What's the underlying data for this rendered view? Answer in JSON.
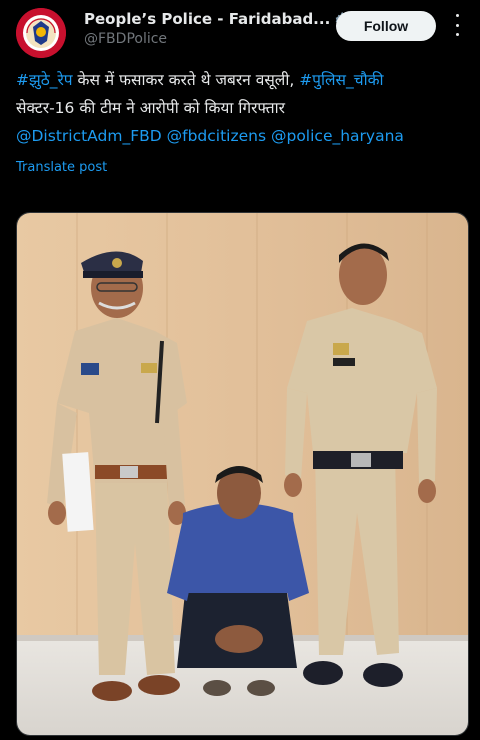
{
  "header": {
    "name": "People’s Police - Faridabad...",
    "handle": "@FBDPolice",
    "follow_label": "Follow"
  },
  "post": {
    "hashtag1": "#झुठे_रेप",
    "text1": " केस में फसाकर करते थे जबरन वसूली, ",
    "hashtag2": "#पुलिस_चौकी",
    "text2": "सेक्टर-16 की टीम ने आरोपी को किया गिरफ्तार",
    "mention1": "@DistrictAdm_FBD",
    "mention2": "@fbdcitizens",
    "mention3": "@police_haryana",
    "translate_label": "Translate post"
  },
  "colors": {
    "background": "#000000",
    "link": "#1d9bf0",
    "text": "#e7e9ea",
    "muted": "#71767b",
    "follow_bg": "#eff3f4"
  },
  "icons": [
    "haryana-police-logo-icon",
    "verified-badge-icon",
    "more-options-icon"
  ]
}
